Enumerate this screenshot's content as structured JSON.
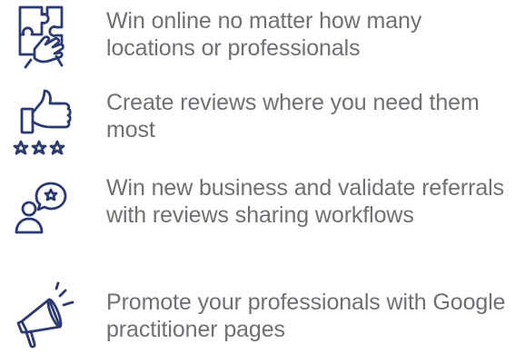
{
  "features": [
    {
      "icon": "puzzle-hand-icon",
      "text": "Win online no matter how many locations or professionals"
    },
    {
      "icon": "thumbs-up-stars-icon",
      "text": "Create reviews where you need them most"
    },
    {
      "icon": "person-speech-star-icon",
      "text": "Win new business and validate referrals with reviews sharing workflows"
    },
    {
      "icon": "megaphone-icon",
      "text": "Promote your professionals with Google practitioner pages"
    }
  ],
  "colors": {
    "icon_stroke": "#2b3a73",
    "text": "#6f7075",
    "background": "#ffffff"
  }
}
